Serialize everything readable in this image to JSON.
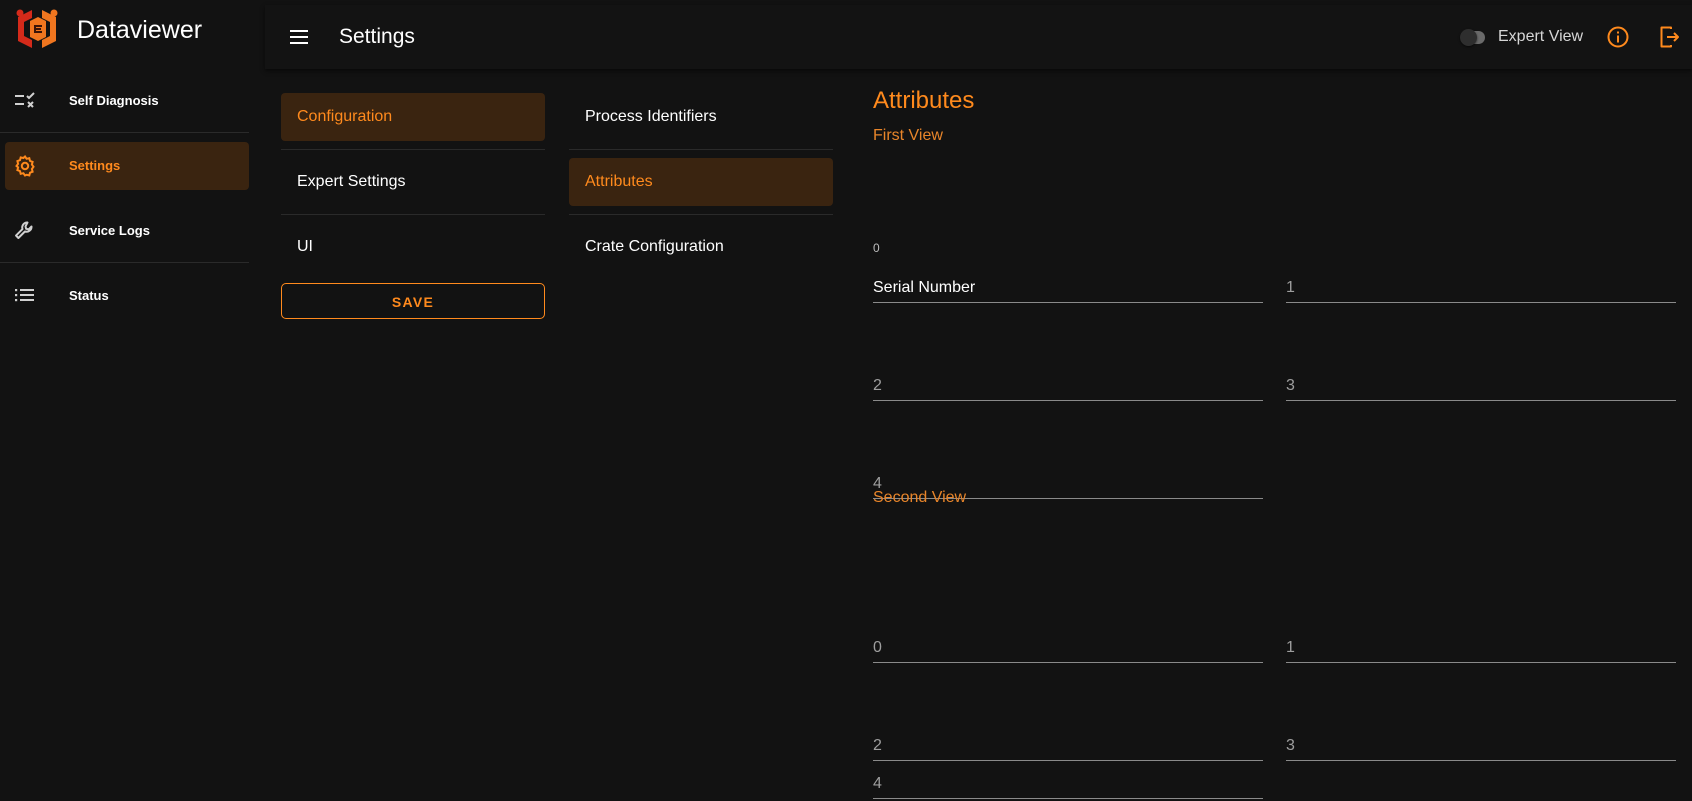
{
  "app": {
    "name": "Dataviewer",
    "brand_colors": {
      "accent": "#ff8a1d",
      "logo_red": "#d42a1a",
      "logo_orange": "#f0761f"
    }
  },
  "sidebar": {
    "items": [
      {
        "label": "Self Diagnosis",
        "icon": "checklist-icon",
        "active": false
      },
      {
        "label": "Settings",
        "icon": "gear-icon",
        "active": true
      },
      {
        "label": "Service Logs",
        "icon": "wrench-icon",
        "active": false
      },
      {
        "label": "Status",
        "icon": "list-icon",
        "active": false
      }
    ]
  },
  "topbar": {
    "title": "Settings",
    "expert_view_label": "Expert View",
    "expert_view_enabled": false
  },
  "settings_menu": {
    "items": [
      {
        "label": "Configuration",
        "active": true
      },
      {
        "label": "Expert Settings",
        "active": false
      },
      {
        "label": "UI",
        "active": false
      }
    ],
    "save_label": "SAVE"
  },
  "config_menu": {
    "items": [
      {
        "label": "Process Identifiers",
        "active": false
      },
      {
        "label": "Attributes",
        "active": true
      },
      {
        "label": "Crate Configuration",
        "active": false
      }
    ]
  },
  "attributes": {
    "title": "Attributes",
    "first_view": {
      "label": "First View",
      "fields": [
        {
          "label": "0",
          "value": "Serial Number"
        },
        {
          "label": "1",
          "value": ""
        },
        {
          "label": "2",
          "value": ""
        },
        {
          "label": "3",
          "value": ""
        },
        {
          "label": "4",
          "value": ""
        }
      ]
    },
    "second_view": {
      "label": "Second View",
      "fields": [
        {
          "label": "0",
          "value": ""
        },
        {
          "label": "1",
          "value": ""
        },
        {
          "label": "2",
          "value": ""
        },
        {
          "label": "3",
          "value": ""
        },
        {
          "label": "4",
          "value": ""
        }
      ]
    }
  }
}
